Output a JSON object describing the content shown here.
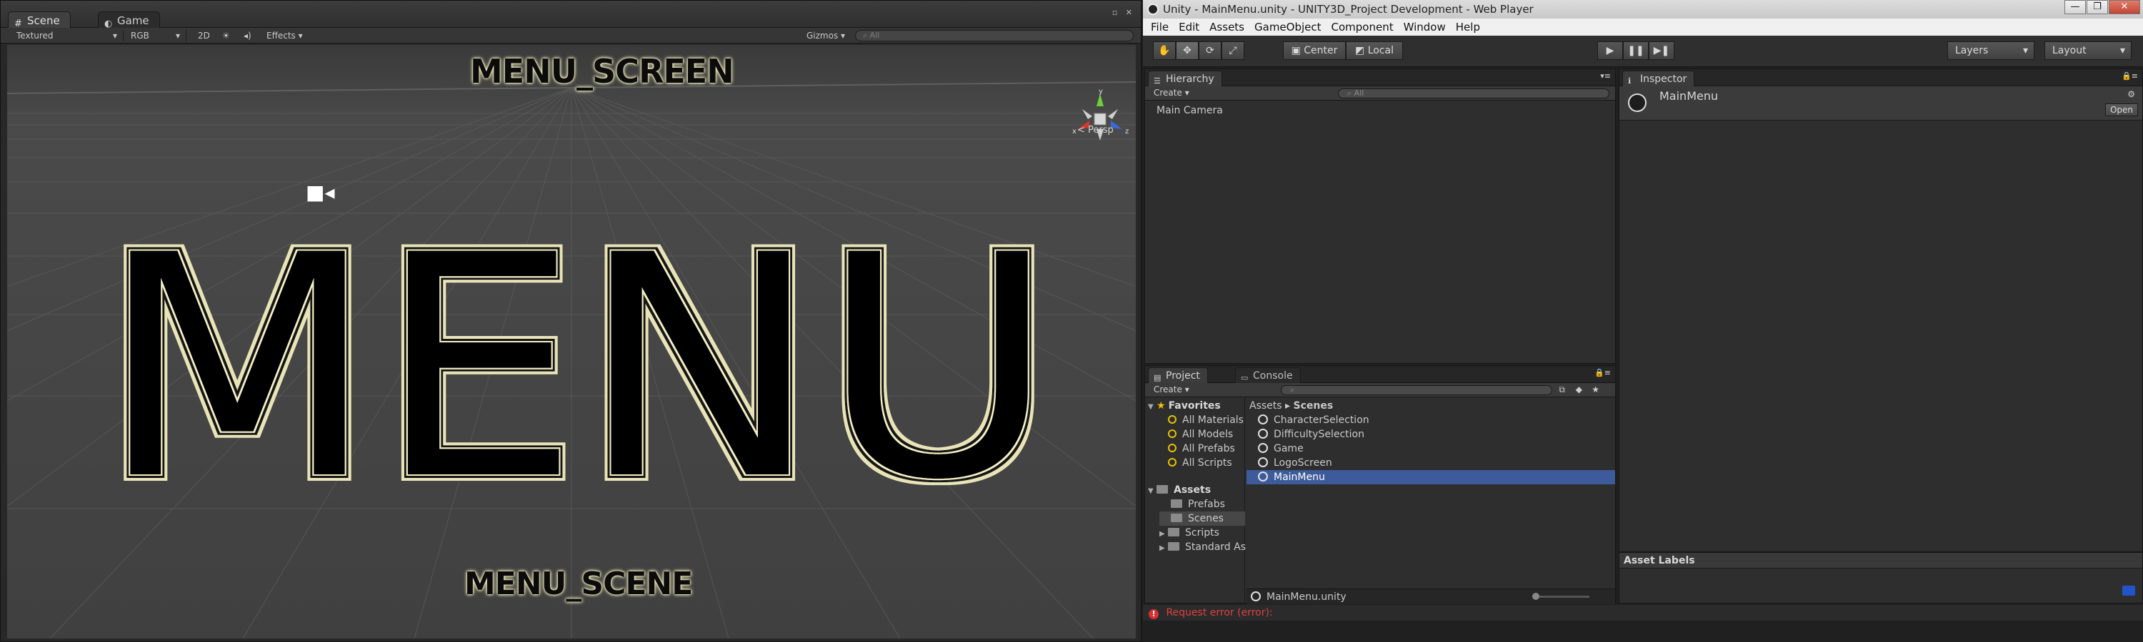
{
  "scene_window": {
    "tabs": [
      "Scene",
      "Game"
    ],
    "toolbar": {
      "shading": "Textured",
      "render_mode": "RGB",
      "mode_2d": "2D",
      "effects": "Effects",
      "gizmos": "Gizmos",
      "search_placeholder": "All"
    },
    "viewport": {
      "top_label": "MENU_SCREEN",
      "big_label": "MENU",
      "bottom_label": "MENU_SCENE",
      "persp_label": "Persp",
      "axes": {
        "x": "x",
        "y": "y",
        "z": "z"
      }
    }
  },
  "unity_window": {
    "title": "Unity - MainMenu.unity - UNITY3D_Project Development - Web Player",
    "menu": [
      "File",
      "Edit",
      "Assets",
      "GameObject",
      "Component",
      "Window",
      "Help"
    ],
    "toolbar": {
      "pivot_label": "Center",
      "space_label": "Local",
      "layers_label": "Layers",
      "layout_label": "Layout"
    },
    "hierarchy": {
      "tab": "Hierarchy",
      "create": "Create",
      "search_placeholder": "All",
      "items": [
        "Main Camera"
      ]
    },
    "inspector": {
      "tab": "Inspector",
      "object_name": "MainMenu",
      "open_button": "Open",
      "asset_labels": "Asset Labels"
    },
    "project": {
      "tabs": [
        "Project",
        "Console"
      ],
      "create": "Create",
      "favorites_label": "Favorites",
      "favorites": [
        "All Materials",
        "All Models",
        "All Prefabs",
        "All Scripts"
      ],
      "assets_label": "Assets",
      "folders": [
        "Prefabs",
        "Scenes",
        "Scripts",
        "Standard As"
      ],
      "breadcrumb": [
        "Assets",
        "Scenes"
      ],
      "files": [
        "CharacterSelection",
        "DifficultySelection",
        "Game",
        "LogoScreen",
        "MainMenu"
      ],
      "selected_file": "MainMenu",
      "footer_file": "MainMenu.unity"
    },
    "status": "Request error (error):"
  },
  "colors": {
    "selection": "#3d5a9a",
    "error": "#e04040",
    "glow": "#f2eebd"
  }
}
